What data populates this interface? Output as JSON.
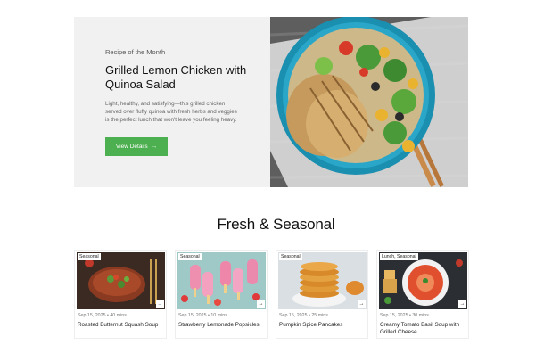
{
  "hero": {
    "eyebrow": "Recipe of the Month",
    "title": "Grilled Lemon Chicken with Quinoa Salad",
    "description": "Light, healthy, and satisfying—this grilled chicken served over fluffy quinoa with fresh herbs and veggies is the perfect lunch that won't leave you feeling heavy.",
    "cta_label": "View Details",
    "cta_arrow": "→",
    "accent": "#4caf50"
  },
  "section": {
    "title": "Fresh & Seasonal"
  },
  "cards": [
    {
      "tag": "Seasonal",
      "date": "Sep 15, 2025",
      "time": "40 mins",
      "title": "Roasted Butternut Squash Soup",
      "arrow": "→"
    },
    {
      "tag": "Seasonal",
      "date": "Sep 15, 2025",
      "time": "10 mins",
      "title": "Strawberry Lemonade Popsicles",
      "arrow": "→"
    },
    {
      "tag": "Seasonal",
      "date": "Sep 15, 2025",
      "time": "25 mins",
      "title": "Pumpkin Spice Pancakes",
      "arrow": "→"
    },
    {
      "tag": "Lunch, Seasonal",
      "date": "Sep 15, 2025",
      "time": "30 mins",
      "title": "Creamy Tomato Basil Soup with Grilled Cheese",
      "arrow": "→"
    }
  ]
}
